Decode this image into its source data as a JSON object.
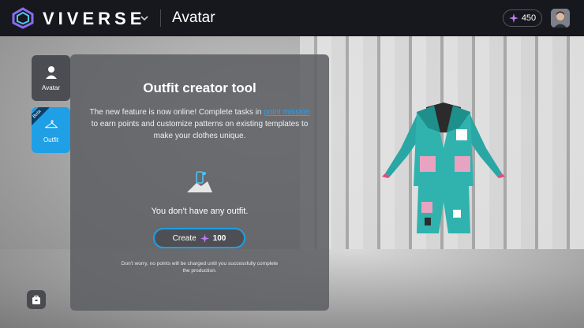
{
  "header": {
    "brand": "VIVERSE",
    "page_title": "Avatar",
    "points": "450",
    "icons": [
      "viverse-logo-icon",
      "chevron-down-icon",
      "sparkle-icon",
      "user-avatar"
    ]
  },
  "sidebar": {
    "items": [
      {
        "label": "Avatar",
        "icon": "person-icon",
        "selected": false
      },
      {
        "label": "Outfit",
        "icon": "hanger-icon",
        "selected": true,
        "badge": "Beta"
      }
    ]
  },
  "panel": {
    "title": "Outfit creator tool",
    "desc_before": "The new feature is now online! Complete tasks in ",
    "desc_link": "point mission",
    "desc_after": " to earn points and customize patterns on existing templates to make your clothes unique.",
    "empty_text": "You don't have any outfit.",
    "create_label": "Create",
    "create_cost": "100",
    "footnote": "Don't worry, no points will be charged until you successfully complete the production."
  },
  "colors": {
    "accent": "#1e9fe6",
    "link": "#27a4f2",
    "topbar": "#17181d",
    "panel": "#5f6064"
  }
}
